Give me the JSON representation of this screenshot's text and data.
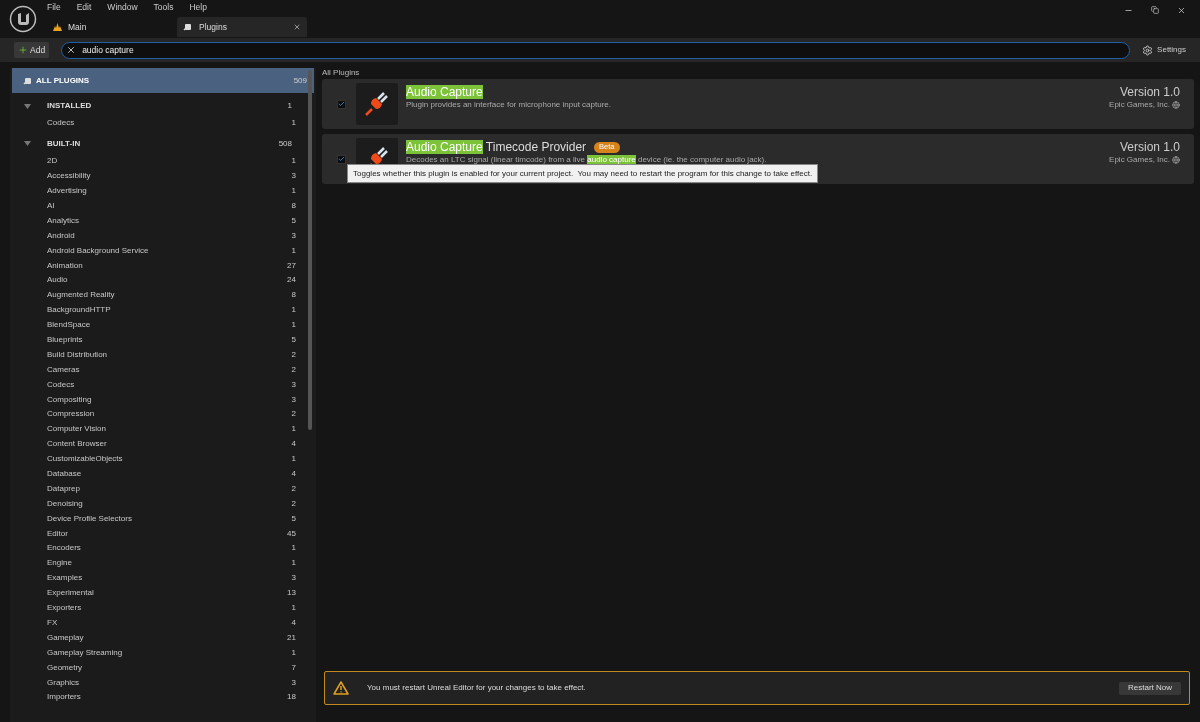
{
  "menu": [
    "File",
    "Edit",
    "Window",
    "Tools",
    "Help"
  ],
  "tabs": [
    {
      "label": "Main",
      "selected": false,
      "kind": "level"
    },
    {
      "label": "Plugins",
      "selected": true,
      "kind": "plugins"
    }
  ],
  "toolbar": {
    "add_button": "Add",
    "search": {
      "value": "audio capture"
    },
    "settings": "Settings"
  },
  "sidebar": {
    "all": {
      "label": "ALL PLUGINS",
      "count": "509",
      "selected": true
    },
    "groups": [
      {
        "label": "INSTALLED",
        "count": "1",
        "expanded": true,
        "children": [
          {
            "label": "Codecs",
            "count": "1"
          }
        ]
      },
      {
        "label": "BUILT-IN",
        "count": "508",
        "expanded": true,
        "children": [
          {
            "label": "2D",
            "count": "1"
          },
          {
            "label": "Accessibility",
            "count": "3"
          },
          {
            "label": "Advertising",
            "count": "1"
          },
          {
            "label": "AI",
            "count": "8"
          },
          {
            "label": "Analytics",
            "count": "5"
          },
          {
            "label": "Android",
            "count": "3"
          },
          {
            "label": "Android Background Service",
            "count": "1"
          },
          {
            "label": "Animation",
            "count": "27"
          },
          {
            "label": "Audio",
            "count": "24"
          },
          {
            "label": "Augmented Reality",
            "count": "8"
          },
          {
            "label": "BackgroundHTTP",
            "count": "1"
          },
          {
            "label": "BlendSpace",
            "count": "1"
          },
          {
            "label": "Blueprints",
            "count": "5"
          },
          {
            "label": "Build Distribution",
            "count": "2"
          },
          {
            "label": "Cameras",
            "count": "2"
          },
          {
            "label": "Codecs",
            "count": "3"
          },
          {
            "label": "Compositing",
            "count": "3"
          },
          {
            "label": "Compression",
            "count": "2"
          },
          {
            "label": "Computer Vision",
            "count": "1"
          },
          {
            "label": "Content Browser",
            "count": "4"
          },
          {
            "label": "CustomizableObjects",
            "count": "1"
          },
          {
            "label": "Database",
            "count": "4"
          },
          {
            "label": "Dataprep",
            "count": "2"
          },
          {
            "label": "Denoising",
            "count": "2"
          },
          {
            "label": "Device Profile Selectors",
            "count": "5"
          },
          {
            "label": "Editor",
            "count": "45"
          },
          {
            "label": "Encoders",
            "count": "1"
          },
          {
            "label": "Engine",
            "count": "1"
          },
          {
            "label": "Examples",
            "count": "3"
          },
          {
            "label": "Experimental",
            "count": "13"
          },
          {
            "label": "Exporters",
            "count": "1"
          },
          {
            "label": "FX",
            "count": "4"
          },
          {
            "label": "Gameplay",
            "count": "21"
          },
          {
            "label": "Gameplay Streaming",
            "count": "1"
          },
          {
            "label": "Geometry",
            "count": "7"
          },
          {
            "label": "Graphics",
            "count": "3"
          },
          {
            "label": "Importers",
            "count": "18"
          }
        ]
      }
    ]
  },
  "breadcrumb": "All Plugins",
  "plugins": [
    {
      "title": [
        {
          "text": "Audio Capture",
          "highlighted": true
        }
      ],
      "description": [
        {
          "text": "Plugin provides an interface for microphone input capture.",
          "highlighted": false
        }
      ],
      "enabled": true,
      "version": "Version 1.0",
      "vendor": "Epic Games, Inc."
    },
    {
      "title": [
        {
          "text": "Audio Capture",
          "highlighted": true
        },
        {
          "text": " Timecode Provider",
          "highlighted": false
        }
      ],
      "badge": "Beta",
      "description": [
        {
          "text": "Decodes an LTC signal (linear timcode) from a live ",
          "highlighted": false
        },
        {
          "text": "audio capture",
          "highlighted": true
        },
        {
          "text": " device (ie. the computer audio jack).",
          "highlighted": false
        }
      ],
      "enabled": true,
      "version": "Version 1.0",
      "vendor": "Epic Games, Inc."
    }
  ],
  "tooltip": "Toggles whether this plugin is enabled for your current project.  You may need to restart the program for this change to take effect.",
  "banner": {
    "message": "You must restart Unreal Editor for your changes to take effect.",
    "button": "Restart Now"
  }
}
